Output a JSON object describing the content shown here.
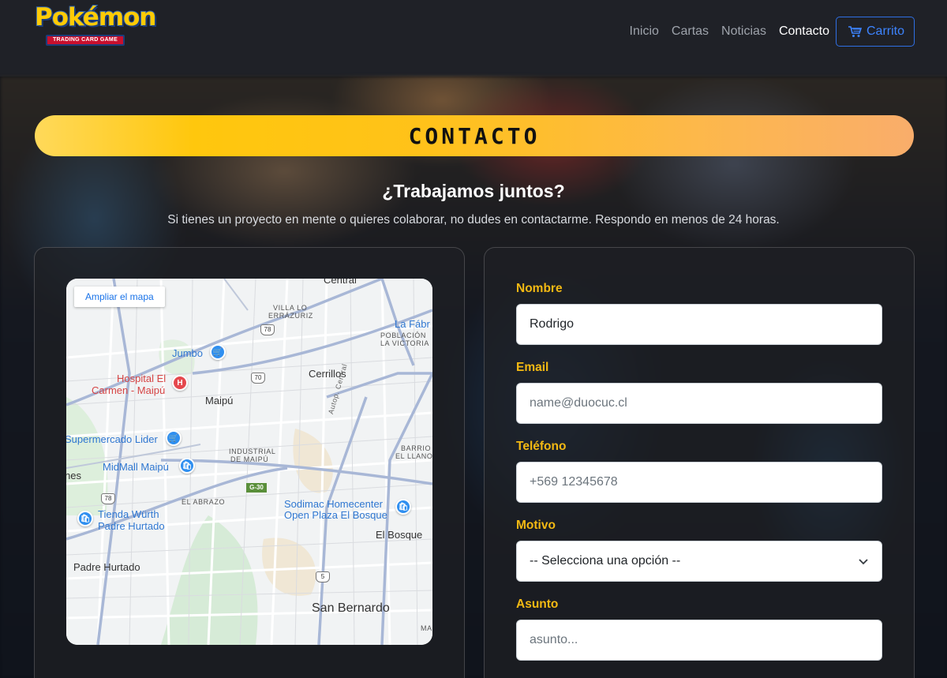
{
  "nav": {
    "brand_word": "Pokémon",
    "brand_sub": "TRADING CARD GAME",
    "links": [
      {
        "label": "Inicio"
      },
      {
        "label": "Cartas"
      },
      {
        "label": "Noticias"
      },
      {
        "label": "Contacto",
        "active": true
      }
    ],
    "cart_label": "Carrito",
    "cart_icon": "cart-icon"
  },
  "page": {
    "title": "CONTACTO",
    "subtitle": "¿Trabajamos juntos?",
    "lead": "Si tienes un proyecto en mente o quieres colaborar, no dudes en contactarme. Respondo en menos de 24 horas."
  },
  "map": {
    "enlarge_label": "Ampliar el mapa",
    "labels": {
      "central": "Central",
      "villa": "VILLA LO",
      "errazuriz": "ERRÁZURIZ",
      "fabrica": "La Fábr",
      "poblacion": "POBLACIÓN",
      "victoria": "LA VICTORIA",
      "jumbo": "Jumbo",
      "hospital1": "Hospital El",
      "hospital2": "Carmen - Maipú",
      "cerrillos": "Cerrillos",
      "maipu": "Maipú",
      "lider": "Supermercado Lider",
      "industrial1": "INDUSTRIAL",
      "industrial2": "DE MAIPÚ",
      "barrio1": "BARRIO",
      "barrio2": "EL LLANO",
      "midmall": "MidMall Maipú",
      "nes": "nes",
      "abrazo": "EL ABRAZO",
      "sodimac1": "Sodimac Homecenter",
      "sodimac2": "Open Plaza El Bosque",
      "wurth1": "Tienda Würth",
      "wurth2": "Padre Hurtado",
      "bosque": "El Bosque",
      "padre": "Padre Hurtado",
      "sanbernardo": "San Bernardo",
      "ma": "MA",
      "autop": "Autop. Central"
    },
    "shields": {
      "r78a": "78",
      "r70": "70",
      "r78b": "78",
      "r5": "5",
      "g30": "G-30"
    }
  },
  "form": {
    "nombre": {
      "label": "Nombre",
      "value": "Rodrigo"
    },
    "email": {
      "label": "Email",
      "placeholder": "name@duocuc.cl"
    },
    "telefono": {
      "label": "Teléfono",
      "placeholder": "+569 12345678"
    },
    "motivo": {
      "label": "Motivo",
      "selected": "-- Selecciona una opción --"
    },
    "asunto": {
      "label": "Asunto",
      "placeholder": "asunto..."
    }
  }
}
